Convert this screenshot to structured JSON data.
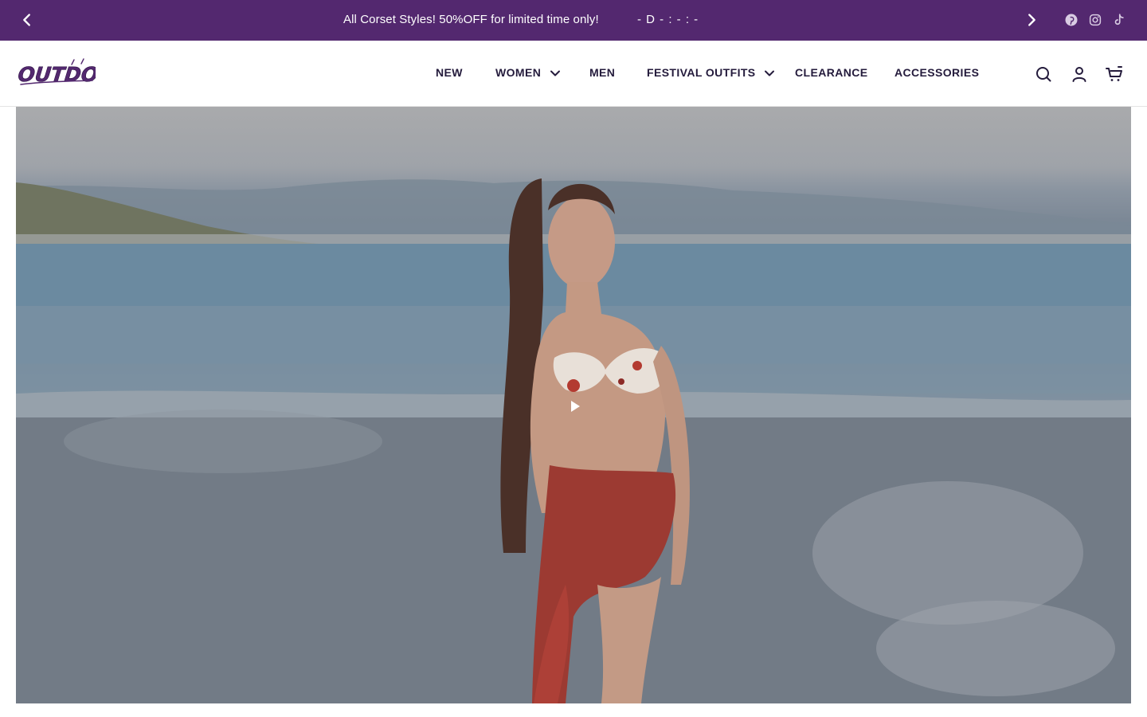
{
  "announcement": {
    "message": "All Corset Styles! 50%OFF for limited time only!",
    "countdown": "- D  - : - : -",
    "prev_icon": "chevron-left-icon",
    "next_icon": "chevron-right-icon",
    "social": [
      "pinterest-icon",
      "instagram-icon",
      "tiktok-icon"
    ],
    "background_color": "#53286f"
  },
  "header": {
    "logo_text": "OUTDOLL",
    "nav": [
      {
        "label": "NEW",
        "has_dropdown": false
      },
      {
        "label": "WOMEN",
        "has_dropdown": true
      },
      {
        "label": "MEN",
        "has_dropdown": false
      },
      {
        "label": "FESTIVAL OUTFITS",
        "has_dropdown": true
      },
      {
        "label": "CLEARANCE",
        "has_dropdown": false
      },
      {
        "label": "ACCESSORIES",
        "has_dropdown": false
      }
    ],
    "icons": [
      "search-icon",
      "account-icon",
      "cart-icon"
    ],
    "text_color": "#241b3c"
  },
  "hero": {
    "type": "video",
    "play_icon": "play-icon"
  }
}
